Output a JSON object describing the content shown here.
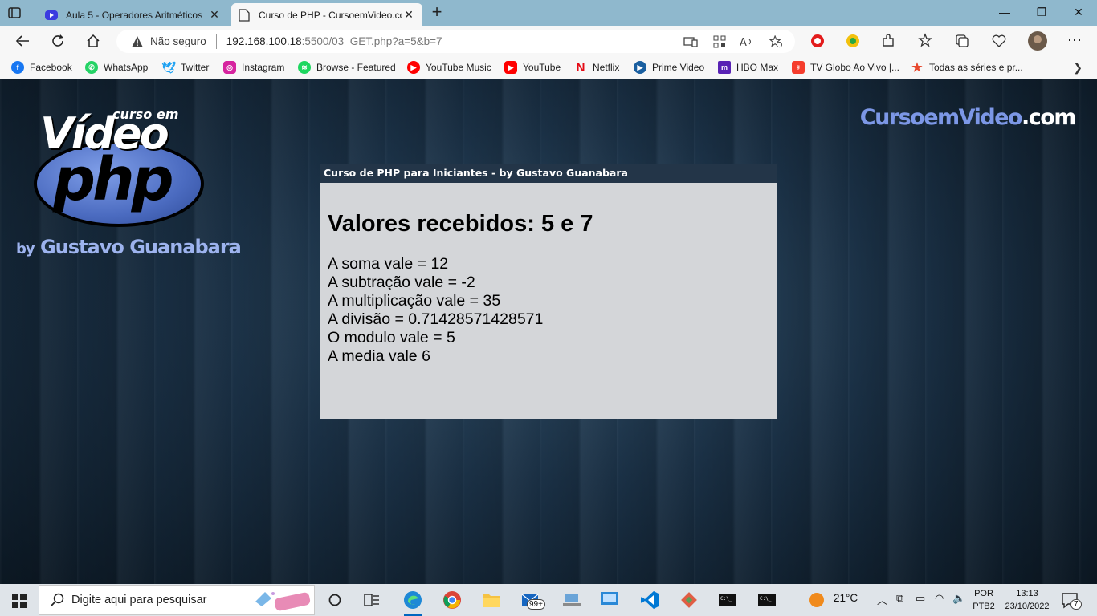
{
  "browser": {
    "tabs": [
      {
        "title": "Aula 5 - Operadores Aritméticos",
        "icon": "youtube-tab-icon",
        "active": false
      },
      {
        "title": "Curso de PHP - CursoemVideo.co",
        "icon": "page-tab-icon",
        "active": true
      }
    ],
    "address": {
      "security_label": "Não seguro",
      "url_host": "192.168.100.18",
      "url_rest": ":5500/03_GET.php?a=5&b=7"
    },
    "bookmarks": [
      {
        "label": "Facebook",
        "icon": "facebook-icon",
        "color": "#1877f2"
      },
      {
        "label": "WhatsApp",
        "icon": "whatsapp-icon",
        "color": "#25d366"
      },
      {
        "label": "Twitter",
        "icon": "twitter-icon",
        "color": "#1da1f2"
      },
      {
        "label": "Instagram",
        "icon": "instagram-icon",
        "color": "#d6249f"
      },
      {
        "label": "Browse - Featured",
        "icon": "spotify-icon",
        "color": "#1ed760"
      },
      {
        "label": "YouTube Music",
        "icon": "youtube-music-icon",
        "color": "#ff0000"
      },
      {
        "label": "YouTube",
        "icon": "youtube-icon",
        "color": "#ff0000"
      },
      {
        "label": "Netflix",
        "icon": "netflix-icon",
        "color": "#e50914"
      },
      {
        "label": "Prime Video",
        "icon": "prime-video-icon",
        "color": "#1a98ff"
      },
      {
        "label": "HBO Max",
        "icon": "hbo-max-icon",
        "color": "#5822b4"
      },
      {
        "label": "TV Globo Ao Vivo |...",
        "icon": "globoplay-icon",
        "color": "#f53d2d"
      },
      {
        "label": "Todas as séries e pr...",
        "icon": "star-icon",
        "color": "#e8492e"
      }
    ]
  },
  "page": {
    "logo": {
      "small": "curso em",
      "video": "Vídeo",
      "php": "php",
      "by_prefix": "by",
      "by_name": "Gustavo Guanabara"
    },
    "brand": {
      "main": "CursoemVideo",
      "suffix": ".com"
    },
    "card": {
      "header": "Curso de PHP para Iniciantes - by Gustavo Guanabara",
      "title": "Valores recebidos: 5 e 7",
      "results": [
        "A soma vale = 12",
        "A subtração vale = -2",
        "A multiplicação vale = 35",
        "A divisão = 0.71428571428571",
        "O modulo vale = 5",
        "A media vale 6"
      ]
    }
  },
  "taskbar": {
    "search_placeholder": "Digite aqui para pesquisar",
    "mail_badge": "99+",
    "weather": "21°C",
    "lang_line1": "POR",
    "lang_line2": "PTB2",
    "time": "13:13",
    "date": "23/10/2022",
    "notification_count": "7"
  }
}
